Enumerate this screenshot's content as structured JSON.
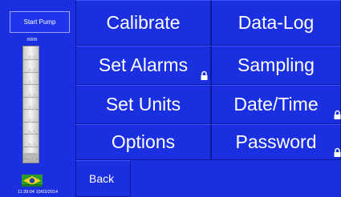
{
  "gauge": {
    "start_pump_label": "Start Pump",
    "unit_label": "ml/m",
    "ticks": [
      "0.9",
      "0.8",
      "0.7",
      "0.6",
      "0.5",
      "0.4",
      "0.3",
      "0.2",
      "0.1"
    ],
    "fill_fraction": 0.08
  },
  "menu": {
    "calibrate": "Calibrate",
    "data_log": "Data-Log",
    "set_alarms": "Set Alarms",
    "sampling": "Sampling",
    "set_units": "Set Units",
    "date_time": "Date/Time",
    "options": "Options",
    "password": "Password",
    "back": "Back"
  },
  "status": {
    "timestamp": "11:39:04 10/02/2014"
  },
  "icons": {
    "set_alarms_lock": "lock-icon",
    "date_time_lock": "lock-icon",
    "password_lock": "lock-icon",
    "logo": "flag-logo-icon"
  },
  "colors": {
    "background": "#1a2fe0",
    "text": "#ffffff",
    "gauge_body": "#e6e6e6"
  }
}
